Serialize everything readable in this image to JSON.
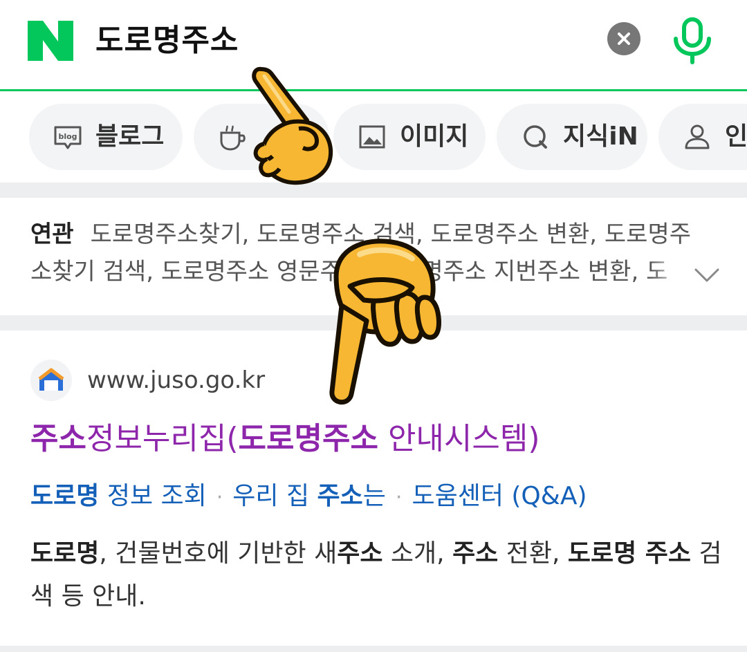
{
  "header": {
    "logo_text": "N",
    "query": "도로명주소",
    "clear_icon": "close-icon",
    "mic_icon": "microphone-icon"
  },
  "chips": [
    {
      "label": "블로그",
      "icon": "blog-icon"
    },
    {
      "label": "",
      "icon": "cafe-icon"
    },
    {
      "label": "이미지",
      "icon": "image-icon"
    },
    {
      "label": "지식iN",
      "icon": "knowledge-icon"
    },
    {
      "label": "인",
      "icon": "person-icon"
    }
  ],
  "related": {
    "label": "연관",
    "terms": "도로명주소찾기, 도로명주소 검색, 도로명주소 변환, 도로명주소찾기 검색, 도로명주소 영문주소, 도로명주소 지번주소 변환, 도"
  },
  "result": {
    "favicon_icon": "house-icon",
    "url": "www.juso.go.kr",
    "title_parts": {
      "p1": "주소",
      "p2": "정보누리집(",
      "p3": "도로명주소",
      "p4": " 안내시스템)"
    },
    "sublinks": {
      "l1_bold": "도로명",
      "l1_rest": " 정보 조회",
      "l2_pre": "우리 집 ",
      "l2_bold": "주소",
      "l2_post": "는",
      "l3": "도움센터 (Q&A)",
      "sep": "·"
    },
    "desc_parts": {
      "d1": "도로명",
      "d2": ", 건물번호에 기반한 새",
      "d3": "주소",
      "d4": " 소개, ",
      "d5": "주소",
      "d6": " 전환, ",
      "d7": "도로명 주소",
      "d8": " 검색 등 안내."
    }
  },
  "colors": {
    "brand_green": "#03c75a",
    "title_purple": "#8d26ab",
    "link_blue": "#1460b8",
    "chip_bg": "#f2f4f6",
    "emoji_yellow": "#f7b733"
  }
}
